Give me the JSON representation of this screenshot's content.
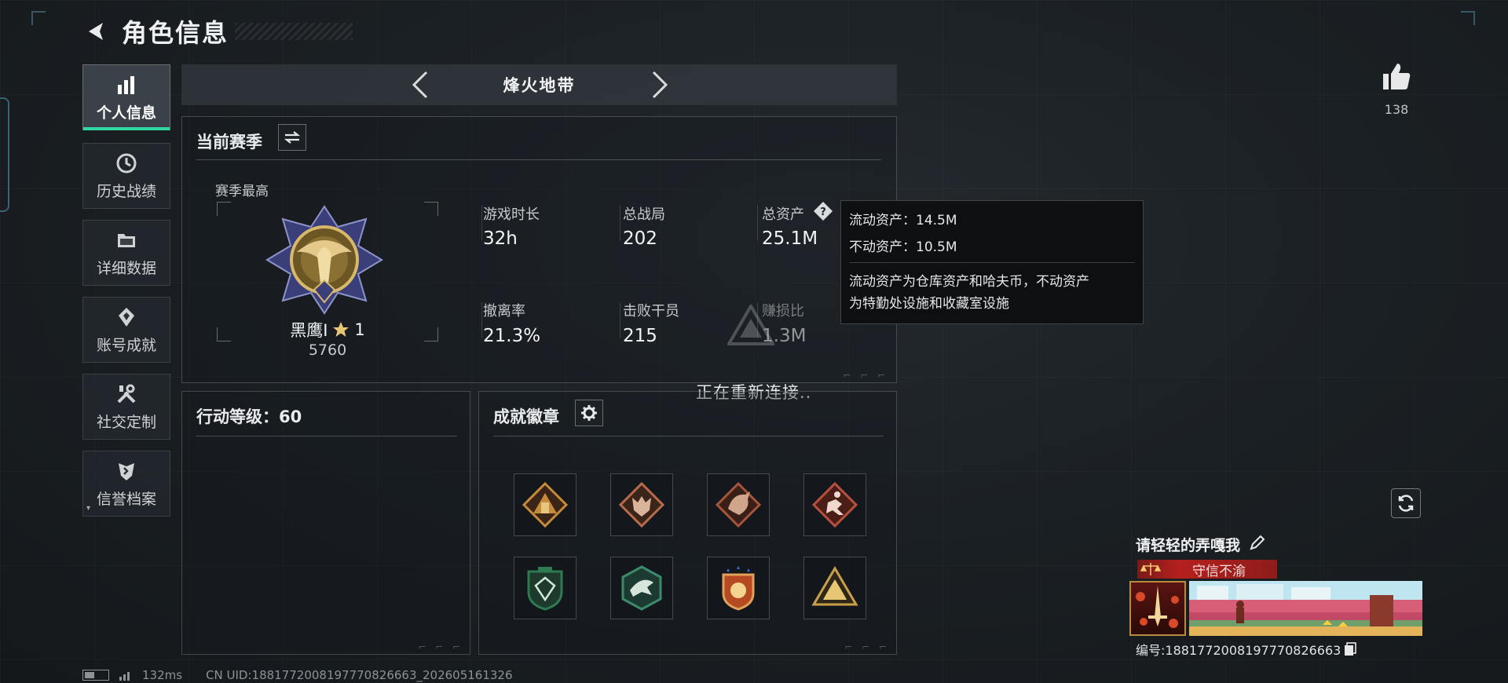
{
  "header": {
    "title": "角色信息"
  },
  "sidebar": {
    "items": [
      {
        "label": "个人信息",
        "icon": "bar-chart-icon",
        "active": true
      },
      {
        "label": "历史战绩",
        "icon": "clock-icon",
        "active": false
      },
      {
        "label": "详细数据",
        "icon": "folder-icon",
        "active": false
      },
      {
        "label": "账号成就",
        "icon": "achievement-icon",
        "active": false
      },
      {
        "label": "社交定制",
        "icon": "tools-icon",
        "active": false
      },
      {
        "label": "信誉档案",
        "icon": "shield-icon",
        "active": false
      }
    ]
  },
  "mode": {
    "name": "烽火地带"
  },
  "season": {
    "title": "当前赛季",
    "best_label": "赛季最高",
    "rank_name": "黑鹰I",
    "rank_stars": "1",
    "rank_score": "5760",
    "stats": [
      {
        "label": "游戏时长",
        "value": "32h"
      },
      {
        "label": "总战局",
        "value": "202"
      },
      {
        "label": "总资产",
        "value": "25.1M"
      },
      {
        "label": "撤离率",
        "value": "21.3%"
      },
      {
        "label": "击败干员",
        "value": "215"
      },
      {
        "label": "赚损比",
        "value": "1.3M"
      }
    ]
  },
  "tooltip": {
    "liquid": "流动资产：14.5M",
    "fixed": "不动资产：10.5M",
    "desc_line1": "流动资产为仓库资产和哈夫币，不动资产",
    "desc_line2": "为特勤处设施和收藏室设施"
  },
  "action_level": {
    "title": "行动等级：60"
  },
  "badges": {
    "title": "成就徽章",
    "items": [
      {
        "icon": "pyramid-badge-icon",
        "color": "#c58a3a"
      },
      {
        "icon": "wolf-badge-icon",
        "color": "#b86a4a"
      },
      {
        "icon": "dragon-badge-icon",
        "color": "#a4553c"
      },
      {
        "icon": "runner-badge-icon",
        "color": "#b5513e"
      },
      {
        "icon": "green-shield-badge-icon",
        "color": "#2f7a52"
      },
      {
        "icon": "eagle-hex-badge-icon",
        "color": "#3b8a6a"
      },
      {
        "icon": "star-shield-badge-icon",
        "color": "#c56a2e"
      },
      {
        "icon": "gold-tent-badge-icon",
        "color": "#c9a04a"
      }
    ]
  },
  "reconnect_text": "正在重新连接..",
  "likes": {
    "count": "138"
  },
  "player": {
    "name": "请轻轻的弄嘎我",
    "title_tag": "守信不渝",
    "uid_text": "编号:1881772008197770826663"
  },
  "status": {
    "ping": "132ms",
    "uid": "CN UID:1881772008197770826663_202605161326"
  },
  "colors": {
    "accent": "#2fd9a0",
    "tag_red": "#b4201e"
  }
}
